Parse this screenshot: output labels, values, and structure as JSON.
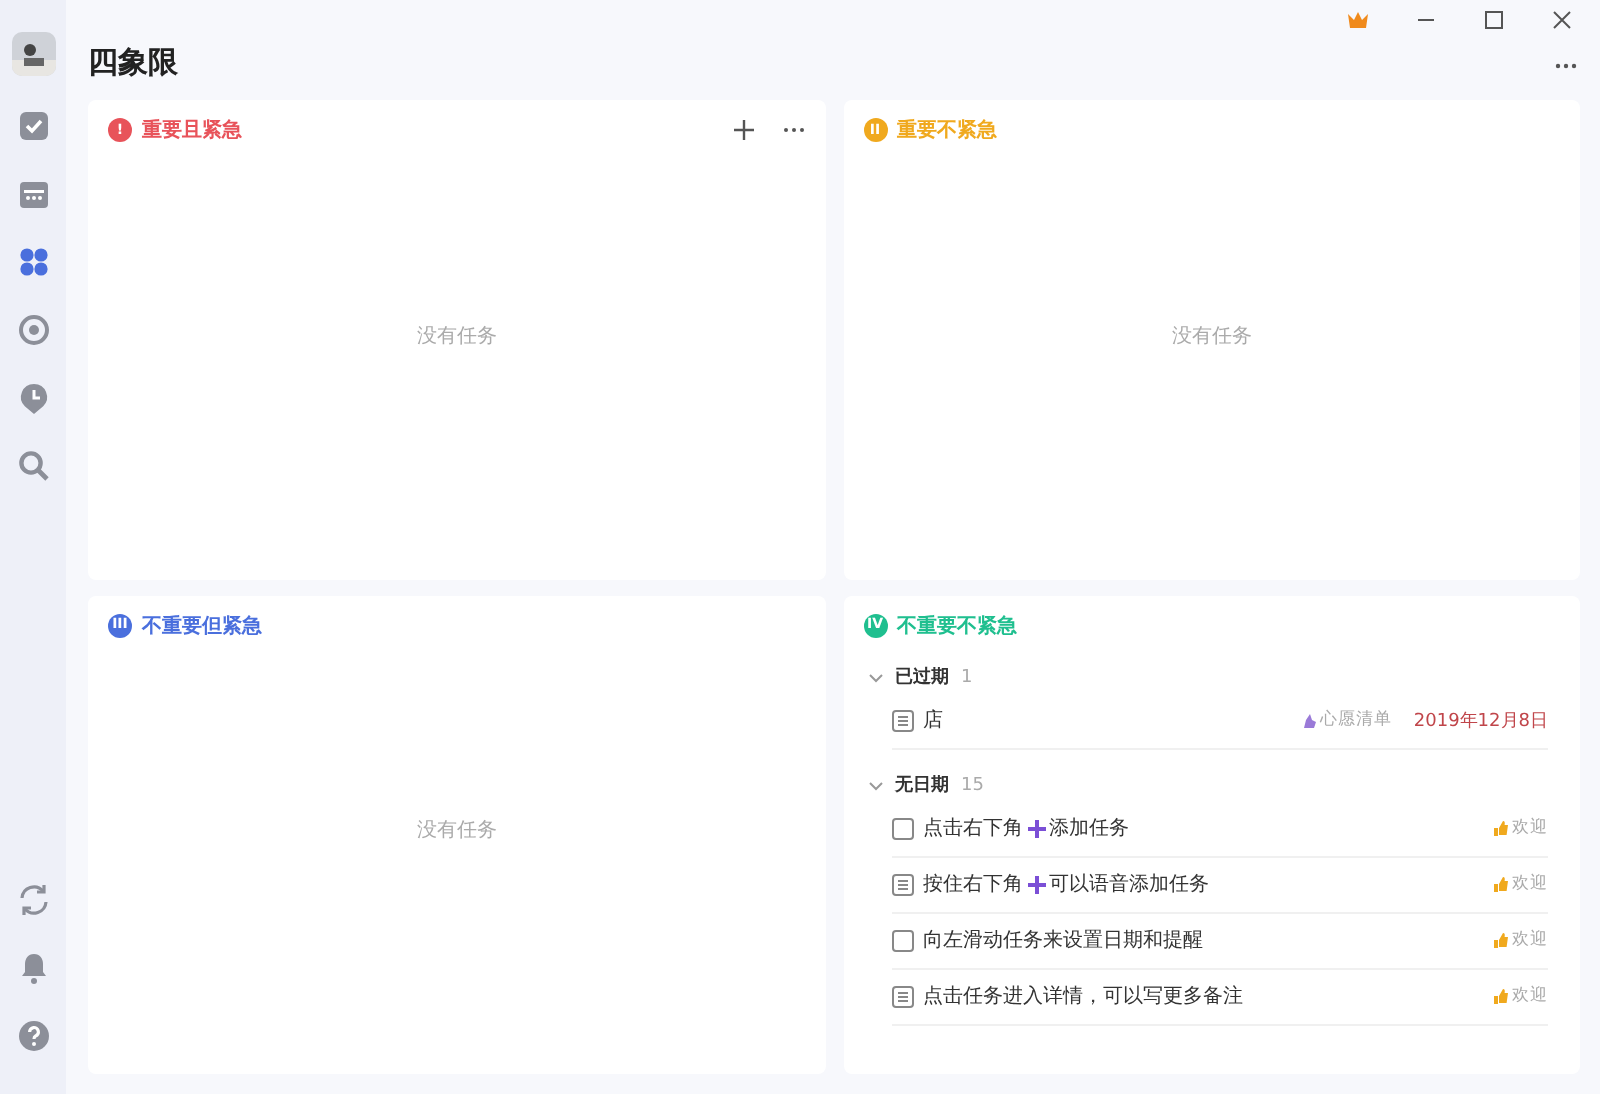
{
  "sidebar": {
    "items": [
      {
        "selected": false
      },
      {
        "selected": false
      },
      {
        "selected": true
      },
      {
        "selected": false
      },
      {
        "selected": false
      },
      {
        "selected": false
      }
    ]
  },
  "title": "四象限",
  "quadrants": [
    {
      "badge": "!",
      "title": "重要且紧急",
      "color": "#e8535a",
      "actions": true,
      "empty": "没有任务"
    },
    {
      "badge": "II",
      "title": "重要不紧急",
      "color": "#f0a91e",
      "actions": false,
      "empty": "没有任务"
    },
    {
      "badge": "III",
      "title": "不重要但紧急",
      "color": "#4a6fdd",
      "actions": false,
      "empty": "没有任务"
    },
    {
      "badge": "IV",
      "title": "不重要不紧急",
      "color": "#1fbf8f",
      "actions": false,
      "groups": [
        {
          "name": "已过期",
          "count": "1",
          "expanded": true,
          "tasks": [
            {
              "kind": "note",
              "parts": [
                "店"
              ],
              "list": "心愿清单",
              "date": "2019年12月8日"
            }
          ]
        },
        {
          "name": "无日期",
          "count": "15",
          "expanded": true,
          "tasks": [
            {
              "kind": "checkbox",
              "checked": false,
              "parts": [
                "点击右下角",
                "添加任务"
              ],
              "tag": "欢迎"
            },
            {
              "kind": "note",
              "parts": [
                "按住右下角",
                "可以语音添加任务"
              ],
              "tag": "欢迎"
            },
            {
              "kind": "checkbox",
              "checked": false,
              "parts": [
                "向左滑动任务来设置日期和提醒"
              ],
              "tag": "欢迎"
            },
            {
              "kind": "note",
              "parts": [
                "点击任务进入详情，可以写更多备注"
              ],
              "tag": "欢迎"
            }
          ]
        }
      ]
    }
  ]
}
